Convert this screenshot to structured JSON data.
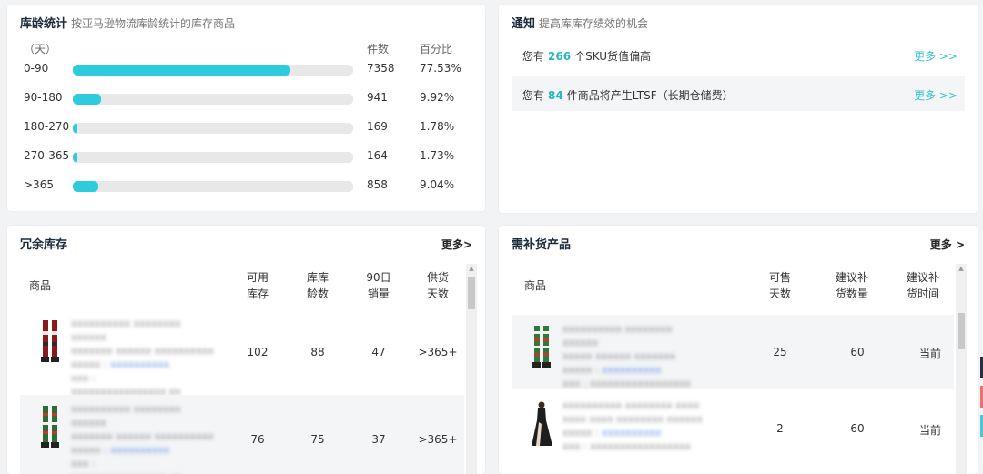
{
  "age_card": {
    "title": "库龄统计",
    "subtitle": "按亚马逊物流库龄统计的库存商品",
    "unit_label": "（天）",
    "count_header": "件数",
    "pct_header": "百分比",
    "rows": [
      {
        "range": "0-90",
        "count": "7358",
        "pct": "77.53%",
        "fill": 77.53
      },
      {
        "range": "90-180",
        "count": "941",
        "pct": "9.92%",
        "fill": 9.92
      },
      {
        "range": "180-270",
        "count": "169",
        "pct": "1.78%",
        "fill": 1.78
      },
      {
        "range": "270-365",
        "count": "164",
        "pct": "1.73%",
        "fill": 1.73
      },
      {
        "range": ">365",
        "count": "858",
        "pct": "9.04%",
        "fill": 9.04
      }
    ],
    "bar_color": "#2ecbdc"
  },
  "notice_card": {
    "title": "通知",
    "subtitle": "提高库库存绩效的机会",
    "items": [
      {
        "prefix": "您有",
        "num": "266",
        "suffix": "个SKU货值偏高",
        "more": "更多 >>"
      },
      {
        "prefix": "您有",
        "num": "84",
        "suffix": "件商品将产生LTSF（长期仓储费）",
        "more": "更多 >>"
      }
    ]
  },
  "redundant_card": {
    "title": "冗余库存",
    "more": "更多>",
    "headers": {
      "product": "商品",
      "avail1": "可用",
      "avail2": "库存",
      "age1": "库库",
      "age2": "龄数",
      "sales1": "90日",
      "sales2": "销量",
      "days1": "供货",
      "days2": "天数"
    },
    "rows": [
      {
        "avail": "102",
        "age": "88",
        "sales": "47",
        "days": ">365+"
      },
      {
        "avail": "76",
        "age": "75",
        "sales": "37",
        "days": ">365+"
      }
    ]
  },
  "restock_card": {
    "title": "需补货产品",
    "more": "更多 >",
    "headers": {
      "product": "商品",
      "sell1": "可售",
      "sell2": "天数",
      "qty1": "建议补",
      "qty2": "货数量",
      "time1": "建议补",
      "time2": "货时间"
    },
    "rows": [
      {
        "sell": "25",
        "qty": "60",
        "time": "当前"
      },
      {
        "sell": "2",
        "qty": "60",
        "time": "当前"
      }
    ]
  }
}
